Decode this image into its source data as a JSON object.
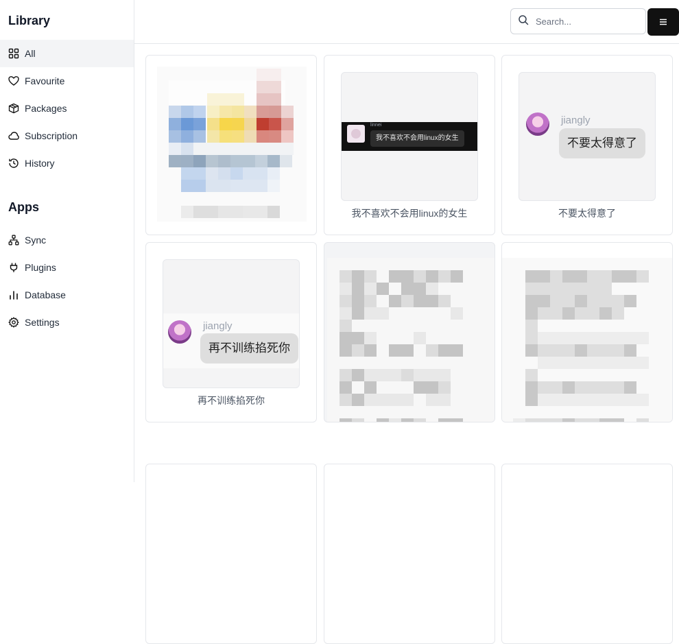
{
  "sidebar": {
    "library_title": "Library",
    "library_items": [
      {
        "label": "All",
        "icon": "grid-icon",
        "active": true
      },
      {
        "label": "Favourite",
        "icon": "heart-icon"
      },
      {
        "label": "Packages",
        "icon": "package-icon"
      },
      {
        "label": "Subscription",
        "icon": "cloud-icon"
      },
      {
        "label": "History",
        "icon": "history-icon"
      }
    ],
    "apps_title": "Apps",
    "apps_items": [
      {
        "label": "Sync",
        "icon": "network-icon"
      },
      {
        "label": "Plugins",
        "icon": "plug-icon"
      },
      {
        "label": "Database",
        "icon": "bar-chart-icon"
      },
      {
        "label": "Settings",
        "icon": "gear-icon"
      }
    ]
  },
  "topbar": {
    "search_placeholder": "Search...",
    "menu_icon": "hamburger-icon"
  },
  "cards": [
    {
      "caption": "",
      "kind": "pixelated-color"
    },
    {
      "caption": "我不喜欢不会用linux的女生",
      "kind": "chat-dark",
      "sender": "linnei",
      "message": "我不喜欢不会用linux的女生"
    },
    {
      "caption": "不要太得意了",
      "kind": "chat-light",
      "sender": "jiangly",
      "message": "不要太得意了"
    },
    {
      "caption": "再不训练掐死你",
      "kind": "chat-light",
      "sender": "jiangly",
      "message": "再不训练掐死你"
    },
    {
      "caption": "",
      "kind": "pixelated-gray"
    },
    {
      "caption": "",
      "kind": "pixelated-gray"
    }
  ]
}
